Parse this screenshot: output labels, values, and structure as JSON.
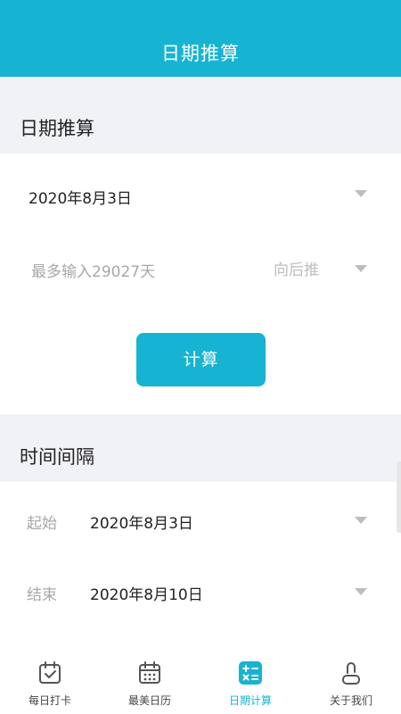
{
  "header": {
    "title": "日期推算"
  },
  "date_calc": {
    "section_title": "日期推算",
    "start_date": "2020年8月3日",
    "days_placeholder": "最多输入29027天",
    "direction": "向后推",
    "calc_button": "计算"
  },
  "interval": {
    "section_title": "时间间隔",
    "start_label": "起始",
    "start_date": "2020年8月3日",
    "end_label": "结束",
    "end_date": "2020年8月10日"
  },
  "tabbar": {
    "items": [
      {
        "label": "每日打卡",
        "icon": "calendar-check-icon"
      },
      {
        "label": "最美日历",
        "icon": "calendar-grid-icon"
      },
      {
        "label": "日期计算",
        "icon": "calculator-icon",
        "active": true
      },
      {
        "label": "关于我们",
        "icon": "user-icon"
      }
    ]
  },
  "colors": {
    "accent": "#17b3d2",
    "background": "#f1f2f6",
    "muted": "#a8a8a8"
  }
}
